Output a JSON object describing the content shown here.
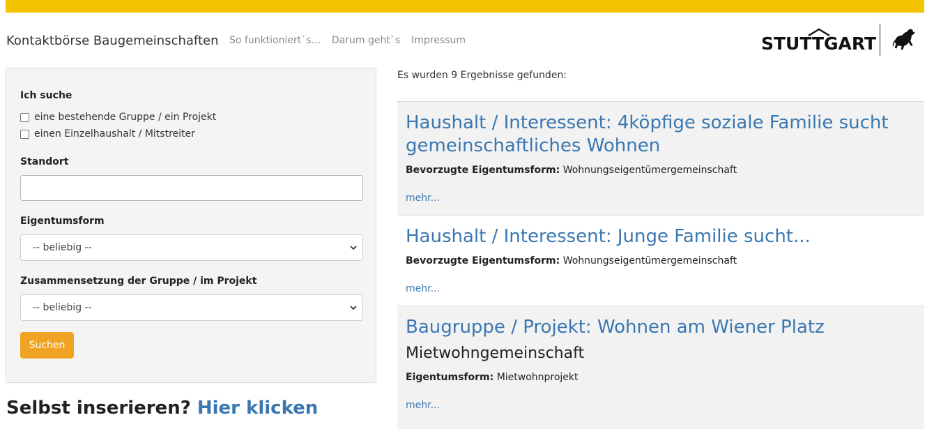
{
  "header": {
    "brand": "Kontaktbörse Baugemeinschaften",
    "nav": [
      "So funktioniert`s...",
      "Darum geht`s",
      "Impressum"
    ],
    "logo_text": "STUTTGART",
    "accent_color": "#f5c400"
  },
  "filter": {
    "ich_suche_label": "Ich suche",
    "option_group": "eine bestehende Gruppe / ein Projekt",
    "option_household": "einen Einzelhaushalt / Mitstreiter",
    "standort_label": "Standort",
    "standort_value": "",
    "eigentumsform_label": "Eigentumsform",
    "eigentumsform_value": "-- beliebig --",
    "zusammensetzung_label": "Zusammensetzung der Gruppe / im Projekt",
    "zusammensetzung_value": "-- beliebig --",
    "search_label": "Suchen",
    "button_color": "#f0a323"
  },
  "self_insert": {
    "prefix": "Selbst inserieren?",
    "link": "Hier klicken"
  },
  "results": {
    "count_text": "Es wurden 9 Ergebnisse gefunden:",
    "items": [
      {
        "title": "Haushalt / Interessent: 4köpfige soziale Familie sucht gemeinschaftliches Wohnen",
        "meta_label": "Bevorzugte Eigentumsform:",
        "meta_value": "Wohnungseigentümergemeinschaft",
        "more": "mehr..."
      },
      {
        "title": "Haushalt / Interessent: Junge Familie sucht...",
        "meta_label": "Bevorzugte Eigentumsform:",
        "meta_value": "Wohnungseigentümergemeinschaft",
        "more": "mehr..."
      },
      {
        "title": "Baugruppe / Projekt: Wohnen am Wiener Platz",
        "subtitle": "Mietwohngemeinschaft",
        "meta_label": "Eigentumsform:",
        "meta_value": "Mietwohnprojekt",
        "more": "mehr..."
      }
    ]
  }
}
